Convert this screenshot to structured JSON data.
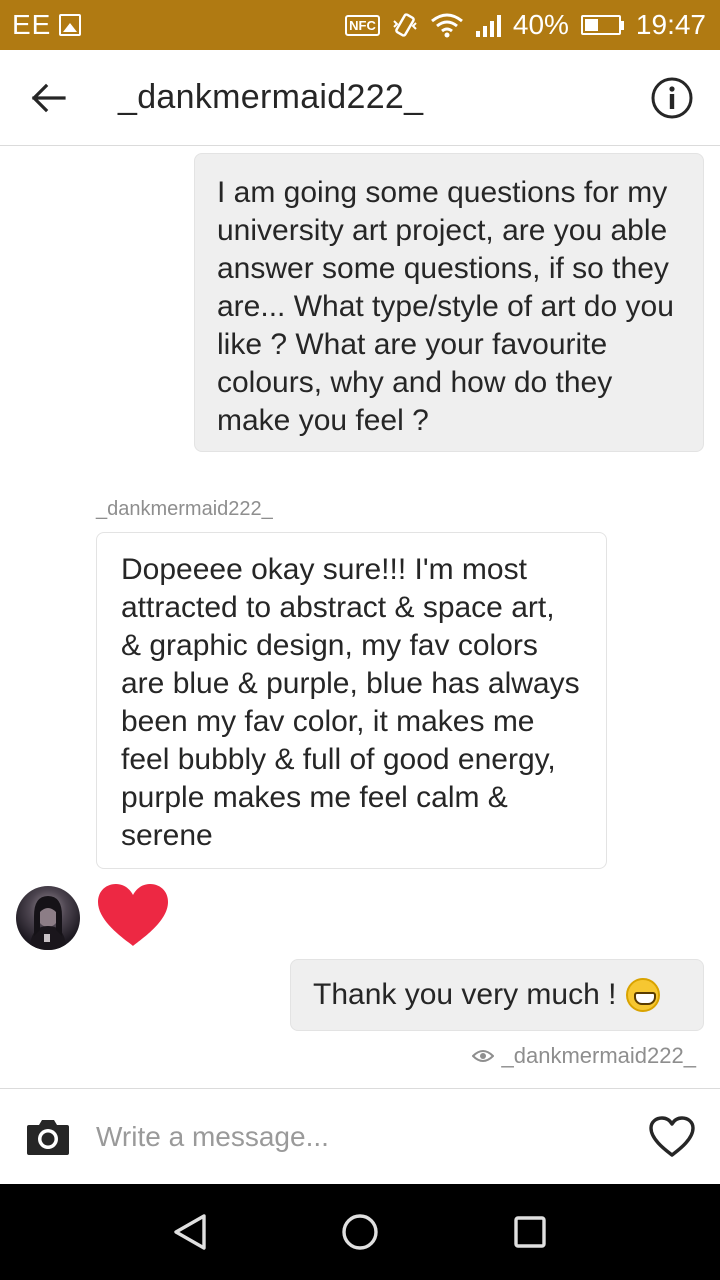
{
  "status_bar": {
    "carrier": "EE",
    "battery_percent": "40%",
    "time": "19:47",
    "nfc_label": "NFC",
    "battery_level": 0.4,
    "icons": [
      "image-icon",
      "nfc-icon",
      "vibrate-icon",
      "wifi-icon",
      "signal-icon",
      "battery-icon"
    ]
  },
  "header": {
    "title": "_dankmermaid222_",
    "back_icon": "arrow-left-icon",
    "info_icon": "info-icon"
  },
  "messages": [
    {
      "direction": "outgoing",
      "text": "I am going some questions for my university art project, are you able answer some questions, if so they are...  What type/style of art do you like ? What are your favourite colours, why and how do they make you feel ?"
    },
    {
      "direction": "incoming",
      "sender": "_dankmermaid222_",
      "text": "Dopeeee okay sure!!! I'm most attracted to abstract & space art, & graphic design, my fav colors are blue & purple, blue has always been my fav color, it makes me feel bubbly & full of good energy, purple makes me feel calm & serene"
    },
    {
      "direction": "incoming",
      "type": "like",
      "icon": "heart-icon"
    },
    {
      "direction": "outgoing",
      "text": "Thank you very much ! ",
      "emoji": "grinning-face-emoji"
    }
  ],
  "seen_by": "_dankmermaid222_",
  "composer": {
    "placeholder": "Write a message...",
    "camera_icon": "camera-icon",
    "like_icon": "heart-outline-icon"
  },
  "colors": {
    "status_bar": "#b07a12",
    "heart": "#ed2843",
    "outgoing_bubble": "#efefef",
    "text": "#262626",
    "muted": "#8e8e8e"
  }
}
